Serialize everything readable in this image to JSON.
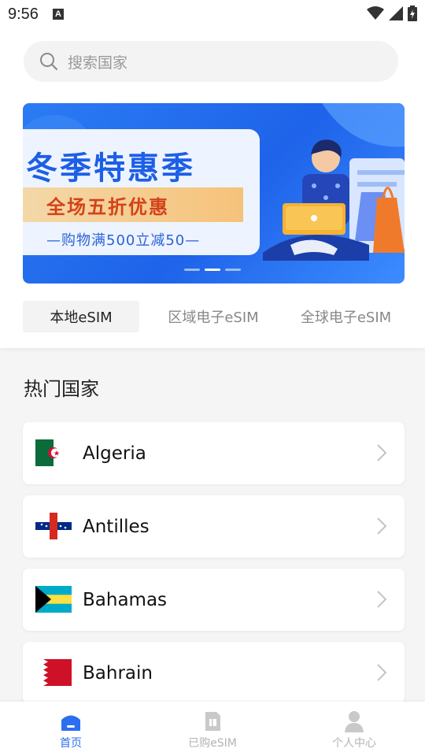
{
  "status_bar": {
    "time": "9:56",
    "notification_letter": "A"
  },
  "search": {
    "placeholder": "搜索国家"
  },
  "banner": {
    "title": "冬季特惠季",
    "highlight": "全场五折优惠",
    "subtitle": "—购物满500立减50—",
    "dots": 3,
    "active_dot": 1
  },
  "tabs": [
    {
      "label": "本地eSIM",
      "active": true
    },
    {
      "label": "区域电子eSIM",
      "active": false
    },
    {
      "label": "全球电子eSIM",
      "active": false
    }
  ],
  "section": {
    "title": "热门国家"
  },
  "countries": [
    {
      "name": "Algeria",
      "flag_icon": "algeria-flag-icon"
    },
    {
      "name": "Antilles",
      "flag_icon": "antilles-flag-icon"
    },
    {
      "name": "Bahamas",
      "flag_icon": "bahamas-flag-icon"
    },
    {
      "name": "Bahrain",
      "flag_icon": "bahrain-flag-icon"
    }
  ],
  "bottom_nav": [
    {
      "label": "首页",
      "icon": "home-icon",
      "active": true
    },
    {
      "label": "已购eSIM",
      "icon": "sim-card-icon",
      "active": false
    },
    {
      "label": "个人中心",
      "icon": "user-icon",
      "active": false
    }
  ],
  "colors": {
    "accent": "#2b6ff0",
    "banner_blue": "#1e63e9",
    "inactive_gray": "#b3b3b3"
  }
}
